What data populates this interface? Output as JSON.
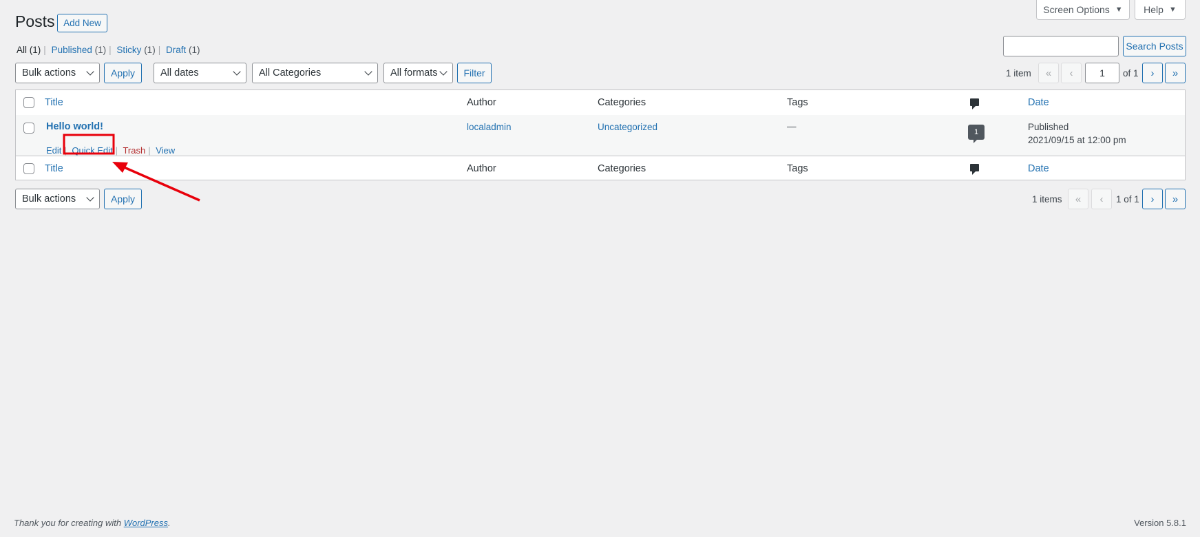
{
  "header": {
    "screen_options": "Screen Options",
    "help": "Help",
    "title": "Posts",
    "add_new": "Add New"
  },
  "views": [
    {
      "label": "All",
      "count": "(1)"
    },
    {
      "label": "Published",
      "count": "(1)"
    },
    {
      "label": "Sticky",
      "count": "(1)"
    },
    {
      "label": "Draft",
      "count": "(1)"
    }
  ],
  "search": {
    "button": "Search Posts",
    "value": ""
  },
  "top_nav": {
    "bulk_actions": "Bulk actions",
    "apply": "Apply",
    "dates": "All dates",
    "categories": "All Categories",
    "formats": "All formats",
    "filter": "Filter",
    "item_count": "1 item",
    "first": "«",
    "prev": "‹",
    "current_page": "1",
    "of_pages": "of 1",
    "next": "›",
    "last": "»"
  },
  "columns": {
    "title": "Title",
    "author": "Author",
    "categories": "Categories",
    "tags": "Tags",
    "date": "Date"
  },
  "post": {
    "title": "Hello world!",
    "author": "localadmin",
    "category": "Uncategorized",
    "tags": "—",
    "comments": "1",
    "status": "Published",
    "date": "2021/09/15 at 12:00 pm",
    "actions": {
      "edit": "Edit",
      "quick_edit": "Quick Edit",
      "trash": "Trash",
      "view": "View"
    }
  },
  "bottom_nav": {
    "bulk_actions": "Bulk actions",
    "apply": "Apply",
    "item_count": "1 items",
    "first": "«",
    "prev": "‹",
    "page_text": "1 of 1",
    "next": "›",
    "last": "»"
  },
  "footer": {
    "thanks_prefix": "Thank you for creating with ",
    "wordpress": "WordPress",
    "thanks_suffix": ".",
    "version": "Version 5.8.1"
  },
  "annotation": {
    "highlight_color": "#e8000b"
  }
}
